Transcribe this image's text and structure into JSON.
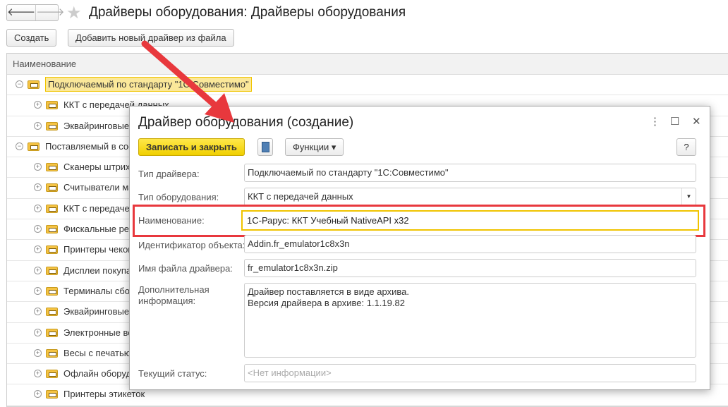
{
  "header": {
    "title": "Драйверы оборудования: Драйверы оборудования",
    "back": "🡐",
    "forward": "🡒",
    "star": "★"
  },
  "toolbar": {
    "create": "Создать",
    "add_from_file": "Добавить новый драйвер из файла"
  },
  "list": {
    "column": "Наименование",
    "rows": [
      {
        "level": 0,
        "toggle": "−",
        "text": "Подключаемый по стандарту \"1С:Совместимо\"",
        "selected": true
      },
      {
        "level": 1,
        "toggle": "+",
        "text": "ККТ с передачей данных"
      },
      {
        "level": 1,
        "toggle": "+",
        "text": "Эквайринговые т"
      },
      {
        "level": 0,
        "toggle": "−",
        "text": "Поставляемый в сос"
      },
      {
        "level": 1,
        "toggle": "+",
        "text": "Сканеры штрих"
      },
      {
        "level": 1,
        "toggle": "+",
        "text": "Считыватели маг"
      },
      {
        "level": 1,
        "toggle": "+",
        "text": "ККТ с передачей"
      },
      {
        "level": 1,
        "toggle": "+",
        "text": "Фискальные рег"
      },
      {
        "level": 1,
        "toggle": "+",
        "text": "Принтеры чеков"
      },
      {
        "level": 1,
        "toggle": "+",
        "text": "Дисплеи покупат"
      },
      {
        "level": 1,
        "toggle": "+",
        "text": "Терминалы сбора"
      },
      {
        "level": 1,
        "toggle": "+",
        "text": "Эквайринговые т"
      },
      {
        "level": 1,
        "toggle": "+",
        "text": "Электронные вес"
      },
      {
        "level": 1,
        "toggle": "+",
        "text": "Весы с печатью"
      },
      {
        "level": 1,
        "toggle": "+",
        "text": "Офлайн оборудо"
      },
      {
        "level": 1,
        "toggle": "+",
        "text": "Принтеры этикеток"
      }
    ]
  },
  "dialog": {
    "title": "Драйвер оборудования (создание)",
    "more": "⋮",
    "maximize": "☐",
    "close": "✕",
    "save_close": "Записать и закрыть",
    "functions": "Функции ▾",
    "help": "?",
    "fields": {
      "driver_type": {
        "label": "Тип драйвера:",
        "value": "Подключаемый по стандарту \"1С:Совместимо\""
      },
      "equipment_type": {
        "label": "Тип оборудования:",
        "value": "ККТ с передачей данных"
      },
      "name": {
        "label": "Наименование:",
        "value": "1С-Рарус: ККТ Учебный NativeAPI x32"
      },
      "object_id": {
        "label": "Идентификатор объекта:",
        "value": "Addin.fr_emulator1c8x3n"
      },
      "file_name": {
        "label": "Имя файла драйвера:",
        "value": "fr_emulator1c8x3n.zip"
      },
      "info": {
        "label": "Дополнительная информация:",
        "line1": "Драйвер поставляется в виде архива.",
        "line2": "Версия драйвера в архиве: 1.1.19.82"
      },
      "status": {
        "label": "Текущий статус:",
        "placeholder": "<Нет информации>"
      }
    }
  },
  "colors": {
    "accent_yellow": "#f5d800",
    "highlight_red": "#e8383d",
    "focus": "#f0c400"
  }
}
